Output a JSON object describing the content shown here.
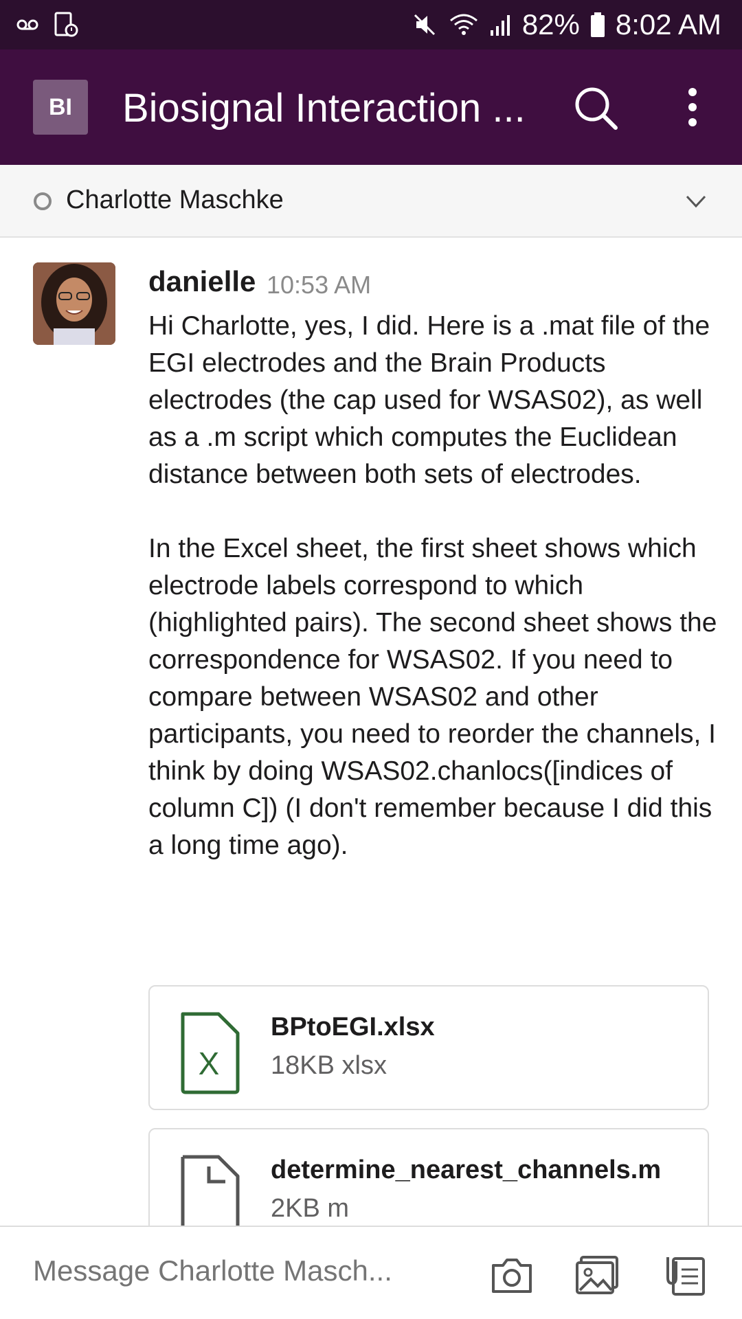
{
  "status_bar": {
    "battery": "82%",
    "time": "8:02 AM"
  },
  "header": {
    "team_initials": "BI",
    "title": "Biosignal Interaction ..."
  },
  "conversation": {
    "name": "Charlotte Maschke"
  },
  "message": {
    "author": "danielle",
    "time": "10:53 AM",
    "paragraphs": [
      "Hi Charlotte, yes, I did. Here is a .mat file of the EGI electrodes and the Brain Products electrodes (the cap used for WSAS02), as well as a .m script which computes the Euclidean distance between both sets of electrodes.",
      "In the Excel sheet, the first sheet shows which electrode labels correspond to which (highlighted pairs). The second sheet shows the correspondence for WSAS02. If you need to compare between WSAS02 and other participants, you need to reorder the channels, I think by doing WSAS02.chanlocs([indices of column C]) (I don't remember because I did this a long time ago)."
    ]
  },
  "files": [
    {
      "name": "BPtoEGI.xlsx",
      "meta": "18KB xlsx",
      "icon": "excel-file-icon"
    },
    {
      "name": "determine_nearest_channels.m",
      "meta": "2KB m",
      "icon": "generic-file-icon"
    }
  ],
  "composer": {
    "placeholder": "Message Charlotte Masch..."
  },
  "colors": {
    "status_bar": "#2c0f2e",
    "header": "#3f0e40",
    "excel_green": "#2f6b34"
  }
}
